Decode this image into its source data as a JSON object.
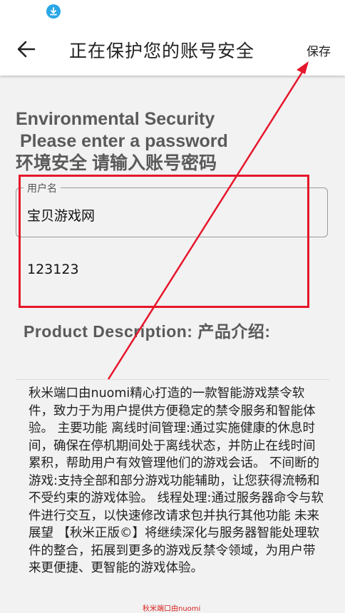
{
  "window": {
    "title": "正在保护您的账号安全",
    "save_label": "保存"
  },
  "status_bar": {
    "icons": [
      "download-icon"
    ]
  },
  "form": {
    "heading_line1": "Environmental Security",
    "heading_line2": "Please enter a password",
    "heading_line3": "环境安全 请输入账号密码",
    "username_label": "用户名",
    "username_value": "宝贝游戏网",
    "password_value": "123123"
  },
  "product": {
    "heading": "Product Description: 产品介绍:",
    "description": "秋米端口由nuomi精心打造的一款智能游戏禁令软件，致力于为用户提供方便稳定的禁令服务和智能体验。 主要功能 离线时间管理:通过实施健康的休息时间，确保在停机期间处于离线状态，并防止在线时间累积，帮助用户有效管理他们的游戏会话。 不间断的游戏:支持全部和部分游戏功能辅助，让您获得流畅和不受约束的游戏体验。 线程处理:通过服务器命令与软件进行交互，以快速修改请求包并执行其他功能 未来展望 【秋米正版©】将继续深化与服务器智能处理软件的整合，拓展到更多的游戏反禁令领域，为用户带来更便捷、更智能的游戏体验。"
  },
  "annotation": {
    "color": "#e6162b",
    "watermark_text": "秋米端口由nuomi"
  }
}
